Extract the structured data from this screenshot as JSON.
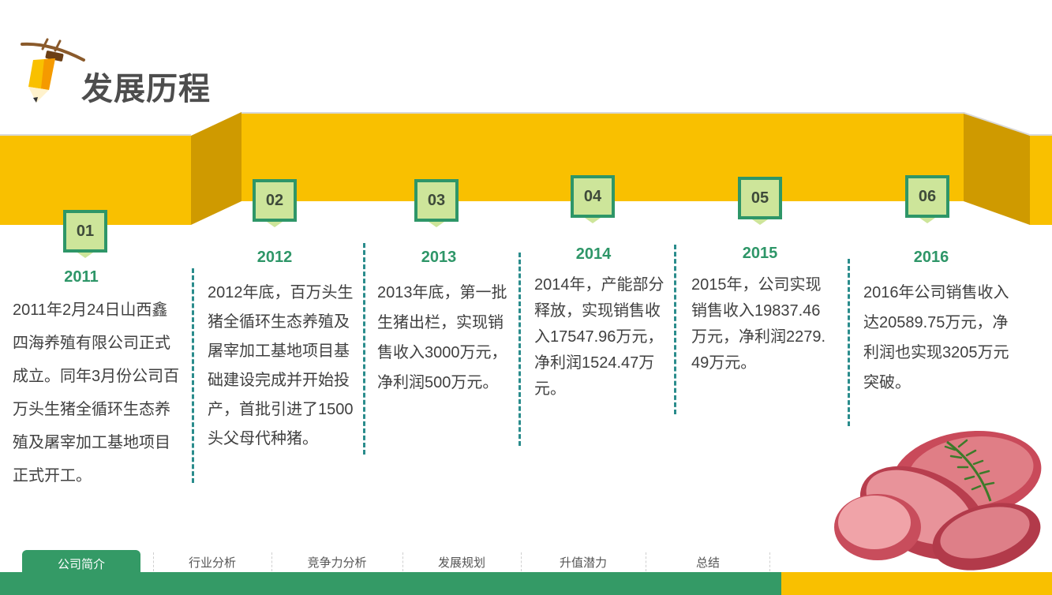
{
  "page_title": "发展历程",
  "timeline": [
    {
      "badge": "01",
      "year": "2011",
      "text": "2011年2月24日山西鑫四海养殖有限公司正式成立。同年3月份公司百万头生猪全循环生态养殖及屠宰加工基地项目正式开工。"
    },
    {
      "badge": "02",
      "year": "2012",
      "text": "2012年底，百万头生猪全循环生态养殖及屠宰加工基地项目基础建设完成并开始投产，首批引进了1500头父母代种猪。"
    },
    {
      "badge": "03",
      "year": "2013",
      "text": "2013年底，第一批生猪出栏，实现销售收入3000万元，净利润500万元。"
    },
    {
      "badge": "04",
      "year": "2014",
      "text": "2014年，产能部分释放，实现销售收入17547.96万元，净利润1524.47万元。"
    },
    {
      "badge": "05",
      "year": "2015",
      "text": "2015年，公司实现销售收入19837.46万元，净利润2279.49万元。"
    },
    {
      "badge": "06",
      "year": "2016",
      "text": "2016年公司销售收入达20589.75万元，净利润也实现3205万元突破。"
    }
  ],
  "nav": [
    "公司简介",
    "行业分析",
    "竞争力分析",
    "发展规划",
    "升值潜力",
    "总结"
  ],
  "colors": {
    "yellow": "#f9c000",
    "yellow_dark": "#cf9a00",
    "green": "#349a66",
    "badge_fill": "#cde59a",
    "dash": "#2a8c8c"
  }
}
